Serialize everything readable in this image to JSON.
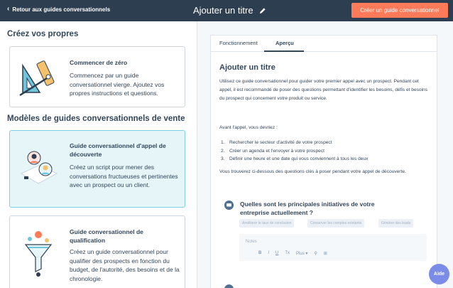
{
  "topbar": {
    "back_label": "Retour aux guides conversationnels",
    "title": "Ajouter un titre",
    "create_label": "Créer un guide conversationnel"
  },
  "left": {
    "own_title": "Créez vos propres",
    "blank": {
      "title": "Commencer de zéro",
      "desc": "Commencez par un guide conversationnel vierge. Ajoutez vos propres instructions et questions."
    },
    "templates_title": "Modèles de guides conversationnels de vente",
    "discovery": {
      "title": "Guide conversationnel d'appel de découverte",
      "desc": "Créez un script pour mener des conversations fructueuses et pertinentes avec un prospect ou un client."
    },
    "qualification": {
      "title": "Guide conversationnel de qualification",
      "desc": "Créez un guide conversationnel pour qualifier des prospects en fonction du budget, de l'autorité, des besoins et de la chronologie."
    }
  },
  "preview": {
    "tabs": [
      "Fonctionnement",
      "Aperçu"
    ],
    "title": "Ajouter un titre",
    "intro": "Utilisez ce guide conversationnel pour guider votre premier appel avec un prospect. Pendant cet appel, il est recommandé de poser des questions permettant d'identifier les besoins, défis et besoins du prospect qui concernent votre produit ou service.",
    "before": "Avant l'appel, vous devriez :",
    "steps": [
      "Rechercher le secteur d'activité de votre prospect",
      "Créer un agenda et l'envoyer à votre prospect",
      "Définir une heure et une date qui vous conviennent à tous les deux"
    ],
    "after": "Vous trouverez ci-dessous des questions clés à poser pendant votre appel de découverte.",
    "question": "Quelles sont les principales initiatives de votre entreprise actuellement ?",
    "chips": [
      "Améliorer le taux de conclusion",
      "Conserver les comptes existants",
      "Générer des leads"
    ],
    "notes_placeholder": "Notes",
    "tools": [
      "B",
      "I",
      "U",
      "Tx",
      "Plus ▾",
      "⚲",
      "⊞"
    ]
  },
  "help_label": "Aide"
}
